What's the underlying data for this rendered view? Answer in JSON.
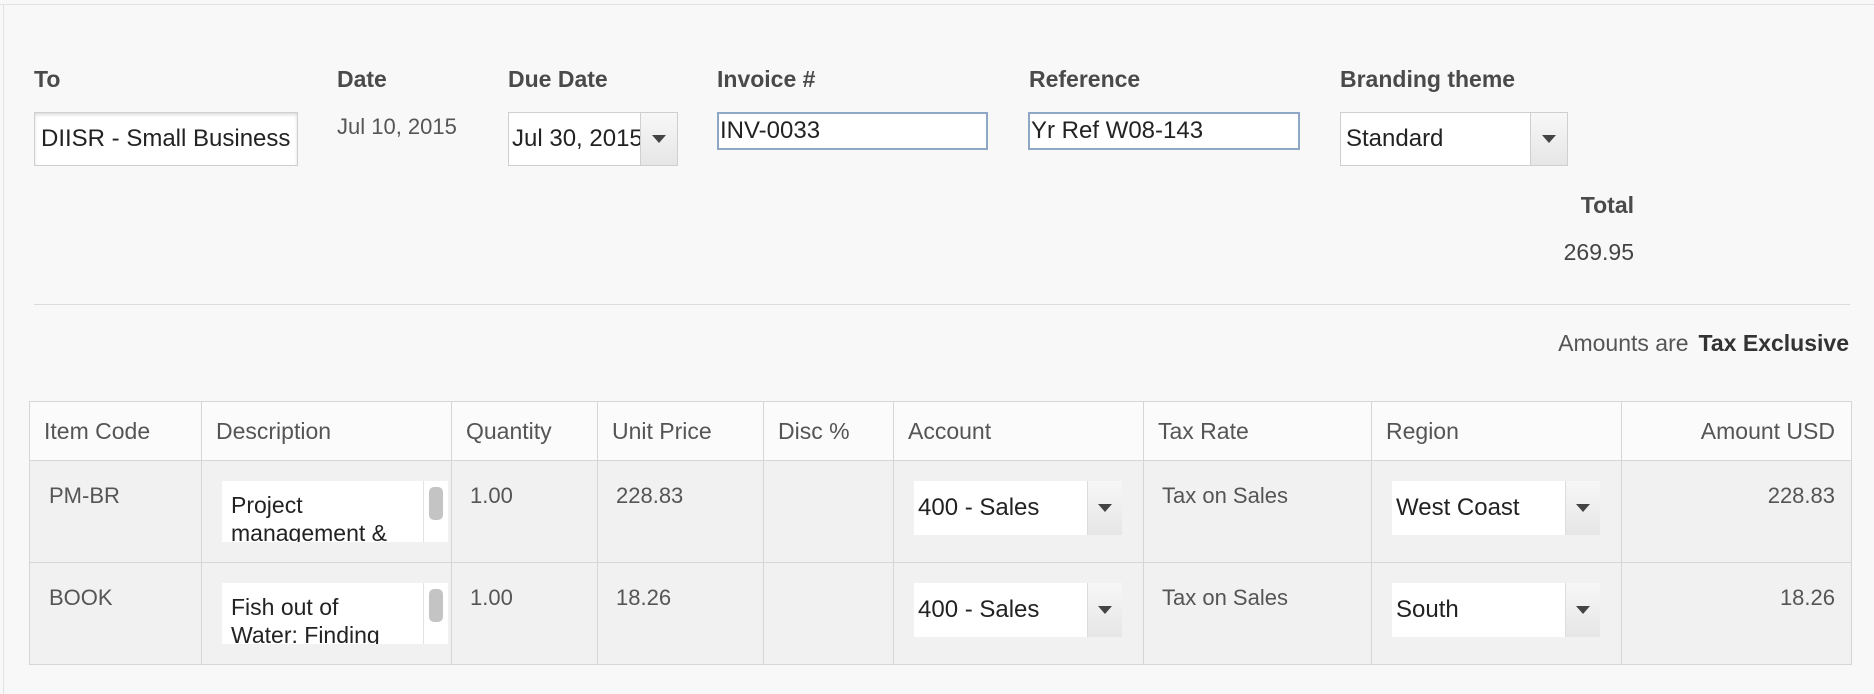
{
  "header": {
    "to": {
      "label": "To",
      "value": "DIISR - Small Business"
    },
    "date": {
      "label": "Date",
      "value": "Jul 10, 2015"
    },
    "due_date": {
      "label": "Due Date",
      "value": "Jul 30, 2015"
    },
    "invoice": {
      "label": "Invoice #",
      "value": "INV-0033"
    },
    "reference": {
      "label": "Reference",
      "value": "Yr Ref W08-143"
    },
    "branding": {
      "label": "Branding theme",
      "value": "Standard"
    }
  },
  "total": {
    "label": "Total",
    "value": "269.95"
  },
  "tax_mode": {
    "prefix": "Amounts are",
    "value": "Tax Exclusive"
  },
  "table": {
    "columns": [
      "Item Code",
      "Description",
      "Quantity",
      "Unit Price",
      "Disc %",
      "Account",
      "Tax Rate",
      "Region",
      "Amount USD"
    ],
    "rows": [
      {
        "item_code": "PM-BR",
        "description": "Project management &",
        "quantity": "1.00",
        "unit_price": "228.83",
        "disc": "",
        "account": "400 - Sales",
        "tax_rate": "Tax on Sales",
        "region": "West Coast",
        "amount": "228.83"
      },
      {
        "item_code": "BOOK",
        "description": "Fish out of Water: Finding",
        "quantity": "1.00",
        "unit_price": "18.26",
        "disc": "",
        "account": "400 - Sales",
        "tax_rate": "Tax on Sales",
        "region": "South",
        "amount": "18.26"
      }
    ]
  },
  "icons": {
    "dropdown": "chevron-down-icon",
    "scroll": "scrollbar-thumb"
  }
}
